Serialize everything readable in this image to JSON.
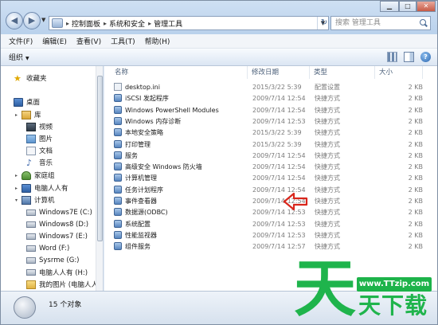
{
  "window": {
    "breadcrumb": [
      "控制面板",
      "系统和安全",
      "管理工具"
    ],
    "search_placeholder": "搜索 管理工具"
  },
  "menu": [
    "文件(F)",
    "编辑(E)",
    "查看(V)",
    "工具(T)",
    "帮助(H)"
  ],
  "toolbar": {
    "organize_label": "组织"
  },
  "nav": {
    "favorites": "收藏夹",
    "desktop": "桌面",
    "libraries": "库",
    "video": "视频",
    "pictures": "图片",
    "documents": "文档",
    "music": "音乐",
    "homegroup": "家庭组",
    "user": "电脑人人有",
    "computer": "计算机",
    "drives": [
      "Windows7E (C:)",
      "Windows8 (D:)",
      "Windows7 (E:)",
      "Word (F:)",
      "Sysrme (G:)",
      "电脑人人有 (H:)"
    ],
    "my_pictures": "我的图片 (电脑人人有)"
  },
  "columns": {
    "name": "名称",
    "date": "修改日期",
    "type": "类型",
    "size": "大小"
  },
  "files": [
    {
      "name": "desktop.ini",
      "date": "2015/3/22 5:39",
      "type": "配置设置",
      "size": "2 KB",
      "icon": "ini-file-icon"
    },
    {
      "name": "iSCSI 发起程序",
      "date": "2009/7/14 12:54",
      "type": "快捷方式",
      "size": "2 KB",
      "icon": "shortcut-icon"
    },
    {
      "name": "Windows PowerShell Modules",
      "date": "2009/7/14 12:54",
      "type": "快捷方式",
      "size": "2 KB",
      "icon": "shortcut-icon"
    },
    {
      "name": "Windows 内存诊断",
      "date": "2009/7/14 12:53",
      "type": "快捷方式",
      "size": "2 KB",
      "icon": "shortcut-icon"
    },
    {
      "name": "本地安全策略",
      "date": "2015/3/22 5:39",
      "type": "快捷方式",
      "size": "2 KB",
      "icon": "shortcut-icon"
    },
    {
      "name": "打印管理",
      "date": "2015/3/22 5:39",
      "type": "快捷方式",
      "size": "2 KB",
      "icon": "shortcut-icon"
    },
    {
      "name": "服务",
      "date": "2009/7/14 12:54",
      "type": "快捷方式",
      "size": "2 KB",
      "icon": "shortcut-icon"
    },
    {
      "name": "高级安全 Windows 防火墙",
      "date": "2009/7/14 12:54",
      "type": "快捷方式",
      "size": "2 KB",
      "icon": "shortcut-icon"
    },
    {
      "name": "计算机管理",
      "date": "2009/7/14 12:54",
      "type": "快捷方式",
      "size": "2 KB",
      "icon": "shortcut-icon"
    },
    {
      "name": "任务计划程序",
      "date": "2009/7/14 12:54",
      "type": "快捷方式",
      "size": "2 KB",
      "icon": "shortcut-icon"
    },
    {
      "name": "事件查看器",
      "date": "2009/7/14 12:54",
      "type": "快捷方式",
      "size": "2 KB",
      "icon": "shortcut-icon"
    },
    {
      "name": "数据源(ODBC)",
      "date": "2009/7/14 12:53",
      "type": "快捷方式",
      "size": "2 KB",
      "icon": "shortcut-icon"
    },
    {
      "name": "系统配置",
      "date": "2009/7/14 12:53",
      "type": "快捷方式",
      "size": "2 KB",
      "icon": "shortcut-icon"
    },
    {
      "name": "性能监视器",
      "date": "2009/7/14 12:53",
      "type": "快捷方式",
      "size": "2 KB",
      "icon": "shortcut-icon"
    },
    {
      "name": "组件服务",
      "date": "2009/7/14 12:57",
      "type": "快捷方式",
      "size": "2 KB",
      "icon": "shortcut-icon"
    }
  ],
  "status": {
    "text": "15 个对象"
  },
  "watermark": {
    "url": "www.TTzip.com",
    "big": "天",
    "rest": "天下载"
  },
  "colors": {
    "arrow": "#d9261c",
    "watermark": "#1fb44c"
  }
}
